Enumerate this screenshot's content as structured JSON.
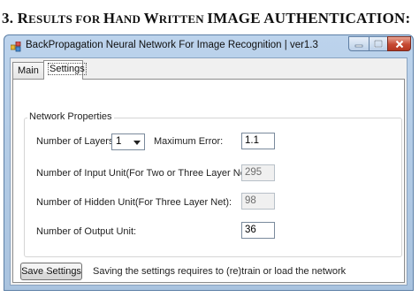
{
  "heading": {
    "number": "3.",
    "text_sc1": "R",
    "text_sc1b": "ESULTS FOR ",
    "text_sc2": "H",
    "text_sc2b": "AND ",
    "text_sc3": "W",
    "text_sc3b": "RITTEN ",
    "text_rest": "IMAGE AUTHENTICATION:"
  },
  "window": {
    "title": "BackPropagation Neural Network For Image Recognition | ver1.3",
    "icon": "app-icon",
    "controls": [
      "minimize",
      "maximize",
      "close"
    ]
  },
  "tabs": [
    {
      "label": "Main"
    },
    {
      "label": "Settings"
    }
  ],
  "settings": {
    "group_label": "Network Properties",
    "layers_label": "Number of Layers:",
    "layers_value": "1",
    "max_error_label": "Maximum Error:",
    "max_error_value": "1.1",
    "input_units_label": "Number of Input Unit(For Two or Three Layer Net):",
    "input_units_value": "295",
    "hidden_units_label": "Number of Hidden Unit(For Three Layer Net):",
    "hidden_units_value": "98",
    "output_units_label": "Number of Output Unit:",
    "output_units_value": "36",
    "save_button": "Save Settings",
    "save_note": "Saving the settings requires to (re)train or load the network"
  },
  "colors": {
    "close": "#c64a33",
    "titlebar": "#bcd3ec"
  }
}
